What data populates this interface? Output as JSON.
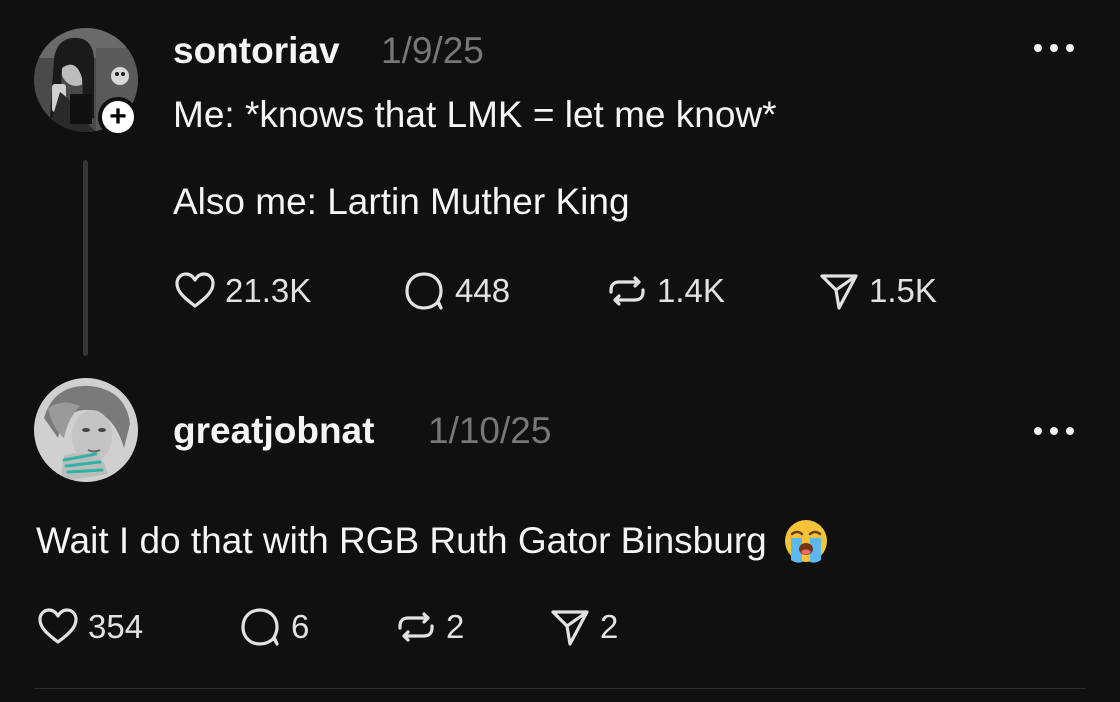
{
  "posts": [
    {
      "username": "sontoriav",
      "date": "1/9/25",
      "text_lines": [
        "Me: *knows that LMK = let me know*",
        "Also me: Lartin Muther King"
      ],
      "follow_icon": "plus-icon",
      "follow_glyph": "+",
      "more_icon": "ellipsis-icon",
      "actions": {
        "like": {
          "icon": "heart-icon",
          "count": "21.3K"
        },
        "reply": {
          "icon": "comment-bubble-icon",
          "count": "448"
        },
        "repost": {
          "icon": "repost-icon",
          "count": "1.4K"
        },
        "share": {
          "icon": "send-icon",
          "count": "1.5K"
        }
      }
    },
    {
      "username": "greatjobnat",
      "date": "1/10/25",
      "text_lines": [
        "Wait I do that with RGB Ruth Gator Binsburg"
      ],
      "emoji": "loudly-crying-face-emoji",
      "more_icon": "ellipsis-icon",
      "actions": {
        "like": {
          "icon": "heart-icon",
          "count": "354"
        },
        "reply": {
          "icon": "comment-bubble-icon",
          "count": "6"
        },
        "repost": {
          "icon": "repost-icon",
          "count": "2"
        },
        "share": {
          "icon": "send-icon",
          "count": "2"
        }
      }
    }
  ],
  "colors": {
    "background": "#101010",
    "primary_text": "#f3f5f7",
    "secondary_text": "#777777",
    "thread_line": "#333638",
    "divider": "#2d2d2d"
  }
}
